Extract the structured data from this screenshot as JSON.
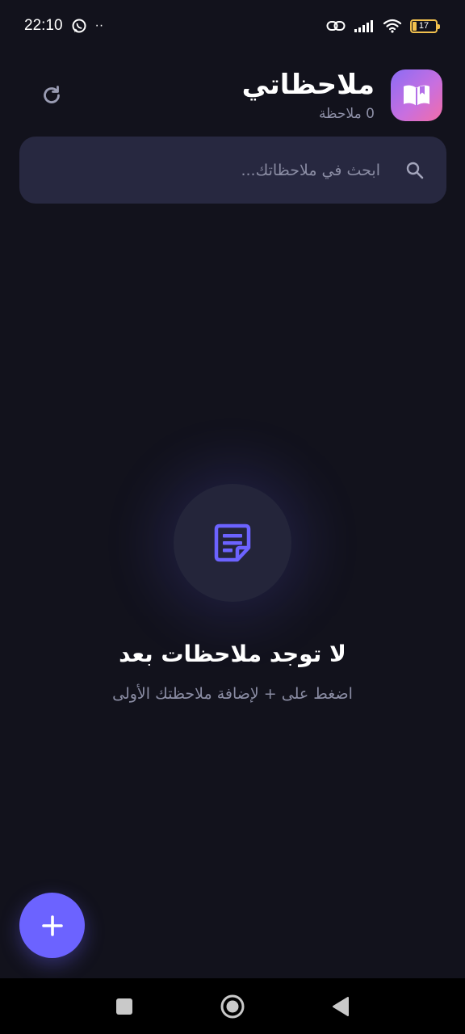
{
  "status_bar": {
    "time": "22:10",
    "dots": "··",
    "battery_level": "17",
    "battery_fraction": 0.17,
    "icons": [
      "whatsapp-icon",
      "link-icon",
      "signal-icon",
      "wifi-icon",
      "battery-icon"
    ]
  },
  "header": {
    "title": "ملاحظاتي",
    "count": "0 ملاحظة",
    "refresh_icon": "refresh-icon",
    "logo_icon": "open-book-icon"
  },
  "search": {
    "placeholder": "ابحث في ملاحظاتك...",
    "value": "",
    "icon": "search-icon"
  },
  "empty_state": {
    "icon": "note-icon",
    "title": "لا توجد ملاحظات بعد",
    "subtitle": "اضغط على + لإضافة ملاحظتك الأولى"
  },
  "fab": {
    "icon": "plus-icon"
  },
  "nav": {
    "icons": [
      "recents-square-icon",
      "home-circle-icon",
      "back-triangle-icon"
    ]
  },
  "colors": {
    "background": "#12121c",
    "surface": "#272840",
    "accent": "#6c63ff",
    "muted_text": "#8a8ca3",
    "logo_gradient": [
      "#8b6cf5",
      "#f26da8"
    ]
  }
}
